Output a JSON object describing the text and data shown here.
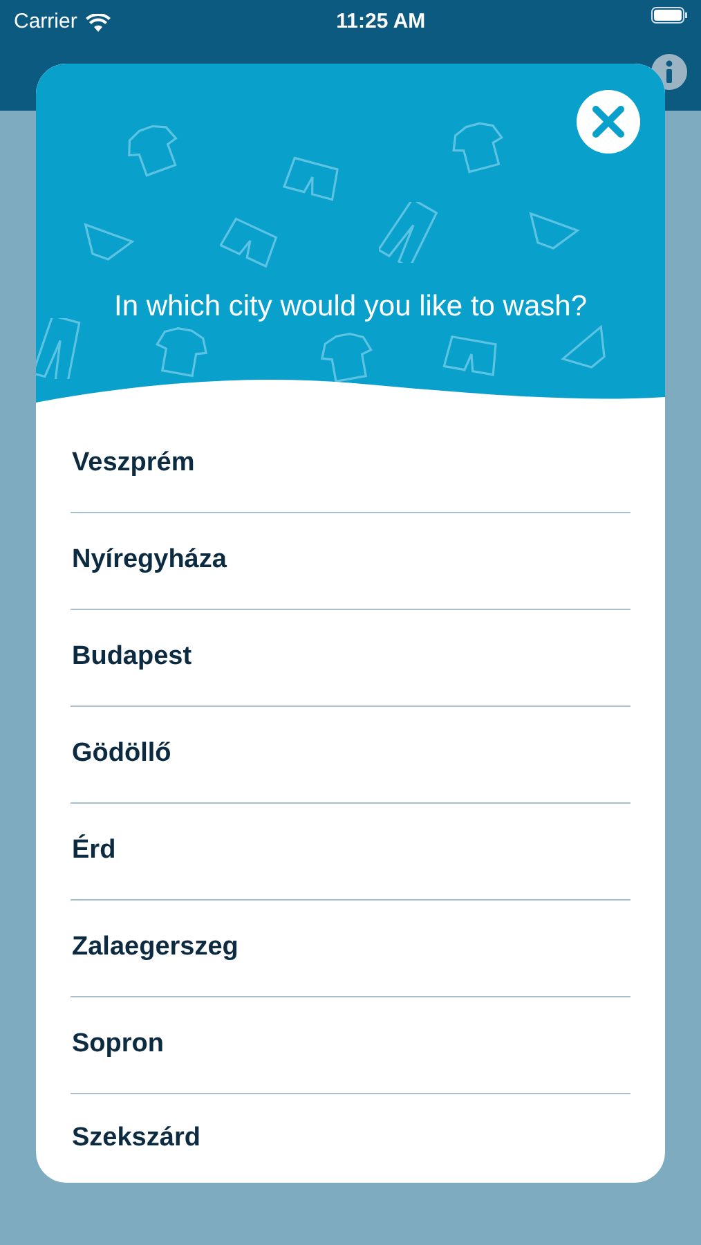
{
  "status_bar": {
    "carrier": "Carrier",
    "time": "11:25 AM"
  },
  "dialog": {
    "title": "In which city would you like to wash?",
    "cities": [
      {
        "name": "Veszprém"
      },
      {
        "name": "Nyíregyháza"
      },
      {
        "name": "Budapest"
      },
      {
        "name": "Gödöllő"
      },
      {
        "name": "Érd"
      },
      {
        "name": "Zalaegerszeg"
      },
      {
        "name": "Sopron"
      },
      {
        "name": "Szekszárd"
      }
    ]
  }
}
